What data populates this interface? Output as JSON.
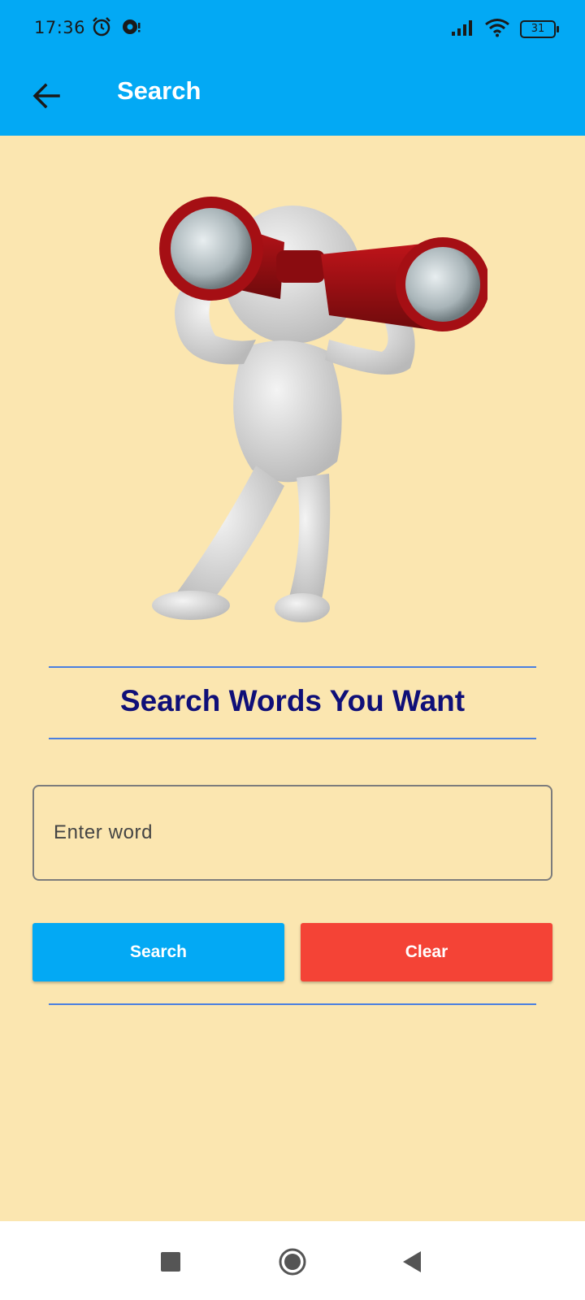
{
  "status_bar": {
    "time": "17:36",
    "battery": "31",
    "icons": [
      "alarm-icon",
      "notification-icon",
      "signal-icon",
      "wifi-icon",
      "battery-icon"
    ]
  },
  "app_bar": {
    "title": "Search",
    "back_icon": "arrow-left-icon",
    "background": "#03a9f4"
  },
  "hero": {
    "icon": "binoculars-figure-illustration"
  },
  "heading": "Search Words You Want",
  "input": {
    "placeholder": "Enter word",
    "value": ""
  },
  "buttons": {
    "search_label": "Search",
    "clear_label": "Clear",
    "search_color": "#03a9f4",
    "clear_color": "#f44336"
  },
  "nav_bar": {
    "icons": [
      "recent-apps-icon",
      "home-icon",
      "back-icon"
    ]
  },
  "colors": {
    "background": "#fbe6b0",
    "heading": "#0f0f78",
    "divider": "#4a7fe0"
  }
}
